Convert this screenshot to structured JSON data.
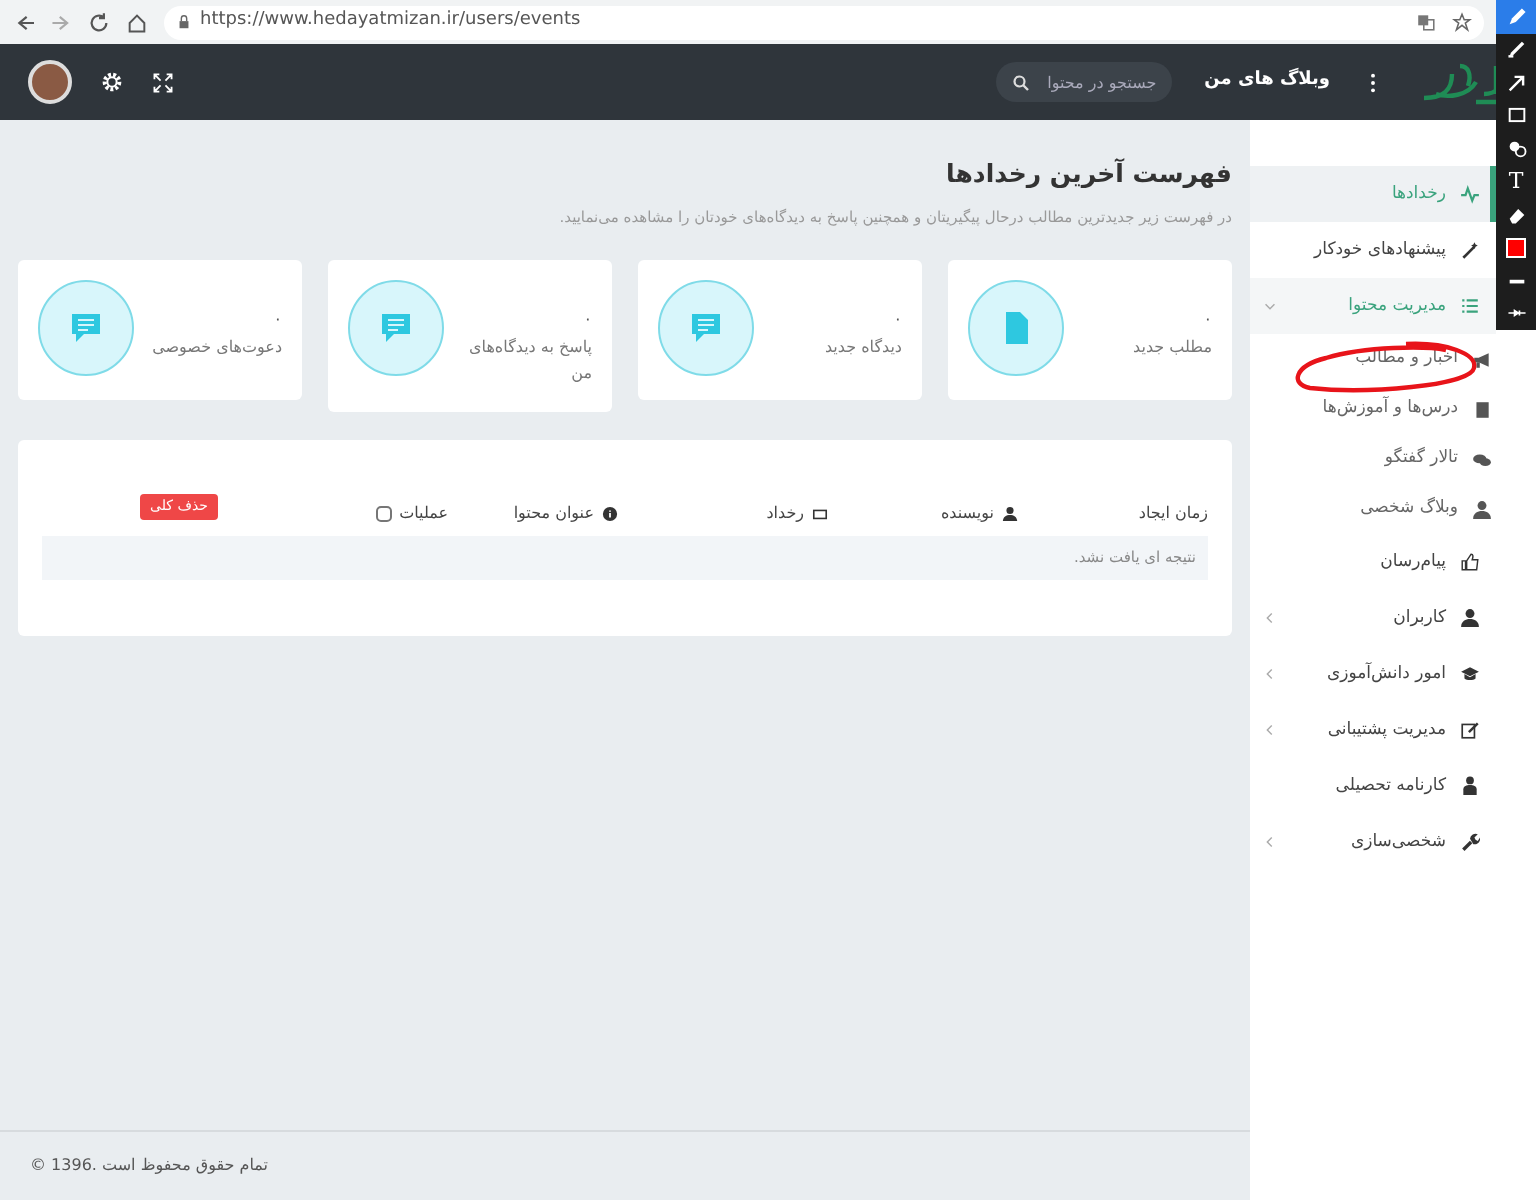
{
  "browser": {
    "url": "https://www.hedayatmizan.ir/users/events"
  },
  "navbar": {
    "menu_label": "وبلاگ های من",
    "search": {
      "placeholder": "جستجو در محتوا"
    }
  },
  "sidebar": {
    "items": [
      {
        "label": "رخدادها",
        "selected": true,
        "expanded": false,
        "has_children": false
      },
      {
        "label": "پیشنهادهای خودکار",
        "selected": false,
        "expanded": false,
        "has_children": false
      },
      {
        "label": "مدیریت محتوا",
        "selected": false,
        "expanded": true,
        "has_children": true,
        "children": [
          {
            "label": "اخبار و مطالب"
          },
          {
            "label": "درس‌ها و آموزش‌ها"
          },
          {
            "label": "تالار گفتگو"
          },
          {
            "label": "وبلاگ شخصی"
          }
        ]
      },
      {
        "label": "پیام‌رسان",
        "selected": false,
        "expanded": false,
        "has_children": false
      },
      {
        "label": "کاربران",
        "selected": false,
        "expanded": false,
        "has_children": true
      },
      {
        "label": "امور دانش‌آموزی",
        "selected": false,
        "expanded": false,
        "has_children": true
      },
      {
        "label": "مدیریت پشتیبانی",
        "selected": false,
        "expanded": false,
        "has_children": true
      },
      {
        "label": "کارنامه تحصیلی",
        "selected": false,
        "expanded": false,
        "has_children": false
      },
      {
        "label": "شخصی‌سازی",
        "selected": false,
        "expanded": false,
        "has_children": true
      }
    ]
  },
  "page": {
    "title": "فهرست آخرین رخدادها",
    "subtitle": "در فهرست زیر جدیدترین مطالب درحال پیگیریتان و همچنین پاسخ به دیدگاه‌های خودتان را مشاهده می‌نمایید."
  },
  "stats": [
    {
      "count": "۰",
      "label": "مطلب جدید"
    },
    {
      "count": "۰",
      "label": "دیدگاه جدید"
    },
    {
      "count": "۰",
      "label": "پاسخ به دیدگاه‌های من"
    },
    {
      "count": "۰",
      "label": "دعوت‌های خصوصی"
    }
  ],
  "table": {
    "columns": [
      {
        "label": "زمان ایجاد"
      },
      {
        "label": "نویسنده"
      },
      {
        "label": "رخداد"
      },
      {
        "label": "عنوان محتوا"
      },
      {
        "label": "عملیات",
        "checked": false
      }
    ],
    "delete_all": "حذف کلی",
    "empty_message": "نتیجه ای یافت نشد."
  },
  "footer": {
    "text": "© 1396. تمام حقوق محفوظ است"
  },
  "annotation_toolbar": {
    "tools": [
      {
        "kind": "pen",
        "selected": true
      },
      {
        "kind": "marker",
        "selected": false
      },
      {
        "kind": "arrow",
        "selected": false
      },
      {
        "kind": "rectangle",
        "selected": false
      },
      {
        "kind": "stamp",
        "selected": false
      },
      {
        "kind": "text",
        "label": "T",
        "selected": false
      },
      {
        "kind": "eraser",
        "selected": false
      },
      {
        "kind": "color",
        "color": "#ff0000",
        "selected": false
      },
      {
        "kind": "line",
        "selected": false
      },
      {
        "kind": "resize",
        "selected": false
      }
    ]
  }
}
